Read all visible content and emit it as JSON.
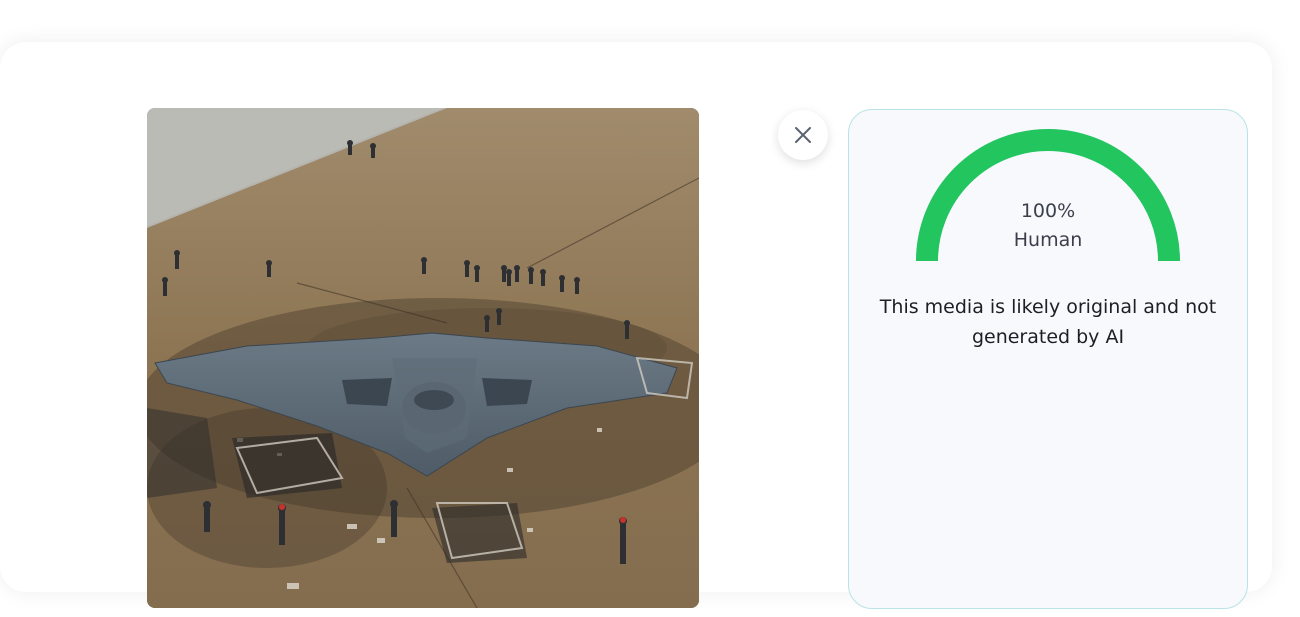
{
  "media": {
    "alt": "Photo of a crashed stealth bomber aircraft on a dirt field surrounded by debris and responders"
  },
  "close_button": {
    "icon": "close-icon"
  },
  "result": {
    "score_percent": 100,
    "score_text": "100%",
    "classification": "Human",
    "message": "This media is likely original and not generated by AI",
    "gauge_color": "#22c55e",
    "panel_bg": "#f7f9fd",
    "panel_border": "#b9e3e6"
  }
}
